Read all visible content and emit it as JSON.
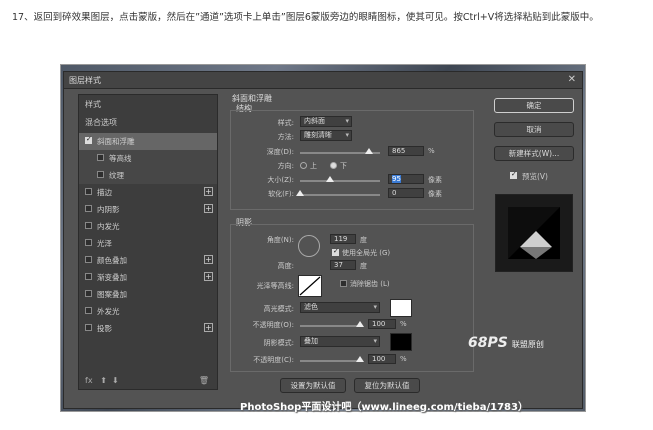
{
  "instruction": "17、返回到碎效果图层，点击蒙版，然后在”通道”选项卡上单击”图层6蒙版旁边的眼睛图标，使其可见。按Ctrl+V将选择粘贴到此蒙版中。",
  "dialog": {
    "title": "图层样式",
    "close_glyph": "✕"
  },
  "left_panel": {
    "styles_header": "样式",
    "blend_options": "混合选项",
    "items": [
      {
        "label": "斜面和浮雕",
        "checked": true,
        "plus": false
      },
      {
        "label": "等高线",
        "checked": false,
        "plus": false
      },
      {
        "label": "纹理",
        "checked": false,
        "plus": false
      },
      {
        "label": "描边",
        "checked": false,
        "plus": true
      },
      {
        "label": "内阴影",
        "checked": false,
        "plus": true
      },
      {
        "label": "内发光",
        "checked": false,
        "plus": false
      },
      {
        "label": "光泽",
        "checked": false,
        "plus": false
      },
      {
        "label": "颜色叠加",
        "checked": false,
        "plus": true
      },
      {
        "label": "渐变叠加",
        "checked": false,
        "plus": true
      },
      {
        "label": "图案叠加",
        "checked": false,
        "plus": false
      },
      {
        "label": "外发光",
        "checked": false,
        "plus": false
      },
      {
        "label": "投影",
        "checked": false,
        "plus": true
      }
    ],
    "fx_label": "fx"
  },
  "bevel": {
    "title": "斜面和浮雕",
    "structure": "结构",
    "style_label": "样式:",
    "style_value": "内斜面",
    "method_label": "方法:",
    "method_value": "雕刻清晰",
    "depth_label": "深度(D):",
    "depth_value": "865",
    "depth_unit": "%",
    "depth_fraction": 0.86,
    "direction_label": "方向:",
    "dir_up": "上",
    "dir_down": "下",
    "size_label": "大小(Z):",
    "size_value": "95",
    "size_unit": "像素",
    "size_fraction": 0.38,
    "soften_label": "软化(F):",
    "soften_value": "0",
    "soften_unit": "像素",
    "soften_fraction": 0.0
  },
  "shading": {
    "title": "阴影",
    "angle_label": "角度(N):",
    "angle_value": "119",
    "angle_unit": "度",
    "global_light": "使用全局光 (G)",
    "altitude_label": "高度:",
    "altitude_value": "37",
    "altitude_unit": "度",
    "gloss_label": "光泽等高线:",
    "antialias": "消除锯齿 (L)",
    "highlight_label": "高光模式:",
    "highlight_mode": "滤色",
    "highlight_opacity_label": "不透明度(O):",
    "highlight_opacity": "100",
    "highlight_opacity_unit": "%",
    "highlight_opacity_fraction": 1.0,
    "shadow_label": "阴影模式:",
    "shadow_mode": "叠加",
    "shadow_opacity_label": "不透明度(C):",
    "shadow_opacity": "100",
    "shadow_opacity_unit": "%",
    "shadow_opacity_fraction": 1.0
  },
  "bottom_buttons": {
    "set_default": "设置为默认值",
    "reset_default": "复位为默认值"
  },
  "right_buttons": {
    "ok": "确定",
    "cancel": "取消",
    "new_style": "新建样式(W)...",
    "preview": "预览(V)"
  },
  "colors": {
    "highlight_color": "#ffffff",
    "shadow_color": "#000000"
  },
  "watermark_logo": "68PS",
  "watermark_logo_sub": "联盟原创",
  "footer_watermark": "PhotoShop平面设计吧（www.lineeg.com/tieba/1783）"
}
